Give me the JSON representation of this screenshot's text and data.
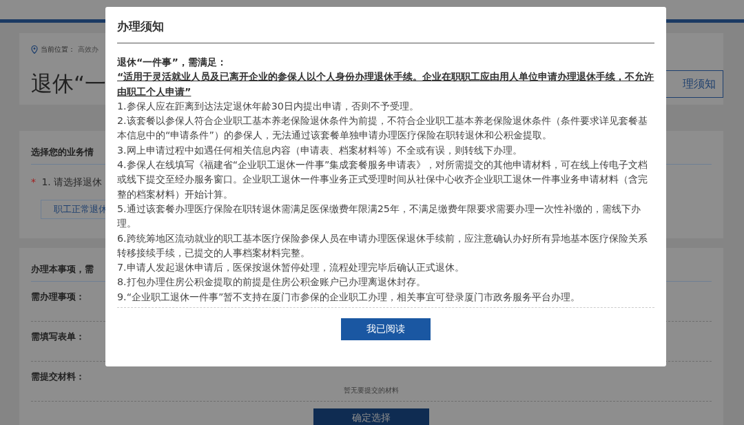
{
  "breadcrumb": {
    "label": "当前位置：",
    "path": "高效办"
  },
  "page_title": "退休“一",
  "notice_button": "理须知",
  "business_section": {
    "heading": "选择您的业务情",
    "question": "1. 请选择退休",
    "required_mark": "*",
    "option": "职工正常退休"
  },
  "requirements_section": {
    "heading": "办理本事项，需",
    "rows": [
      {
        "label": "需办理事项："
      },
      {
        "label": "需填写表单："
      },
      {
        "label": "需提交材料：",
        "value": "暂无要提交的材料"
      }
    ]
  },
  "confirm_button": "确定选择",
  "modal": {
    "title": "办理须知",
    "intro": "退休“一件事”，需满足：",
    "condition": "“适用于灵活就业人员及已离开企业的参保人以个人身份办理退休手续。企业在职职工应由用人单位申请办理退休手续，不允许由职工个人申请”",
    "items": [
      "1.参保人应在距离到达法定退休年龄30日内提出申请，否则不予受理。",
      "2.该套餐以参保人符合企业职工基本养老保险退休条件为前提，不符合企业职工基本养老保险退休条件（条件要求详见套餐基本信息中的“申请条件”）的参保人，无法通过该套餐单独申请办理医疗保险在职转退休和公积金提取。",
      "3.网上申请过程中如遇任何相关信息内容（申请表、档案材料等）不全或有误，则转线下办理。",
      "4.参保人在线填写《福建省“企业职工退休一件事”集成套餐服务申请表》，对所需提交的其他申请材料，可在线上传电子文档或线下提交至经办服务窗口。企业职工退休一件事业务正式受理时间从社保中心收齐企业职工退休一件事业务申请材料（含完整的档案材料）开始计算。",
      "5.通过该套餐办理医疗保险在职转退休需满足医保缴费年限满25年，不满足缴费年限要求需要办理一次性补缴的，需线下办理。",
      "6.跨统筹地区流动就业的职工基本医疗保险参保人员在申请办理医保退休手续前，应注意确认办好所有异地基本医疗保险关系转移接续手续，已提交的人事档案材料完整。",
      "7.申请人发起退休申请后，医保按退休暂停处理，流程处理完毕后确认正式退休。",
      "8.打包办理住房公积金提取的前提是住房公积金账户已办理离退休封存。",
      "9.“企业职工退休一件事”暂不支持在厦门市参保的企业职工办理，相关事宜可登录厦门市政务服务平台办理。"
    ],
    "confirm": "我已阅读"
  }
}
